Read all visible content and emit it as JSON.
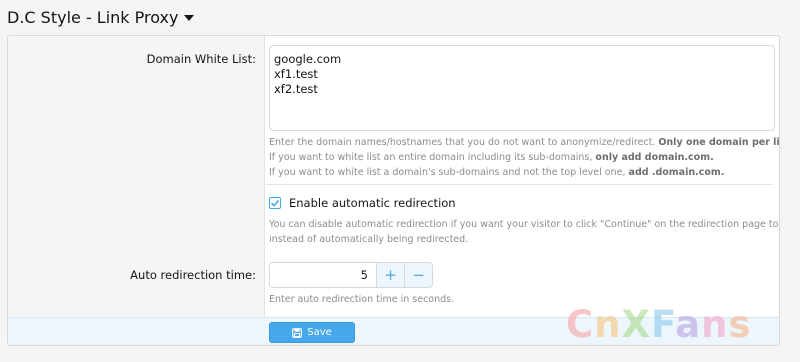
{
  "header": {
    "title": "D.C Style - Link Proxy",
    "caret_icon": "caret-down-icon"
  },
  "domain_white_list": {
    "label": "Domain White List:",
    "lines": [
      "google.com",
      "xf1.test",
      "xf2.test"
    ],
    "hint": [
      {
        "text": "Enter the domain names/hostnames that you do not want to anonymize/redirect. ",
        "bold": "Only one domain per line."
      },
      {
        "text": "If you want to white list an entire domain including its sub-domains, ",
        "bold": "only add domain.com."
      },
      {
        "text": "If you want to white list a domain's sub-domains and not the top level one, ",
        "bold": "add .domain.com."
      }
    ]
  },
  "auto_redirect": {
    "checked": true,
    "label": "Enable automatic redirection",
    "hint": [
      "You can disable automatic redirection if you want your visitor to click \"Continue\" on the redirection page to visit the page,",
      "instead of automatically being redirected."
    ]
  },
  "redirection_time": {
    "label": "Auto redirection time:",
    "value": "5",
    "plus": "+",
    "minus": "−",
    "hint": "Enter auto redirection time in seconds."
  },
  "footer": {
    "save_label": "Save",
    "save_icon": "save-icon"
  },
  "watermark": {
    "letters": [
      "C",
      "n",
      "X",
      "F",
      "a",
      "n",
      "s"
    ]
  },
  "colors": {
    "accent": "#47a7eb",
    "footer_bg": "#edf6fd",
    "label_bg": "#f5f5f5"
  }
}
